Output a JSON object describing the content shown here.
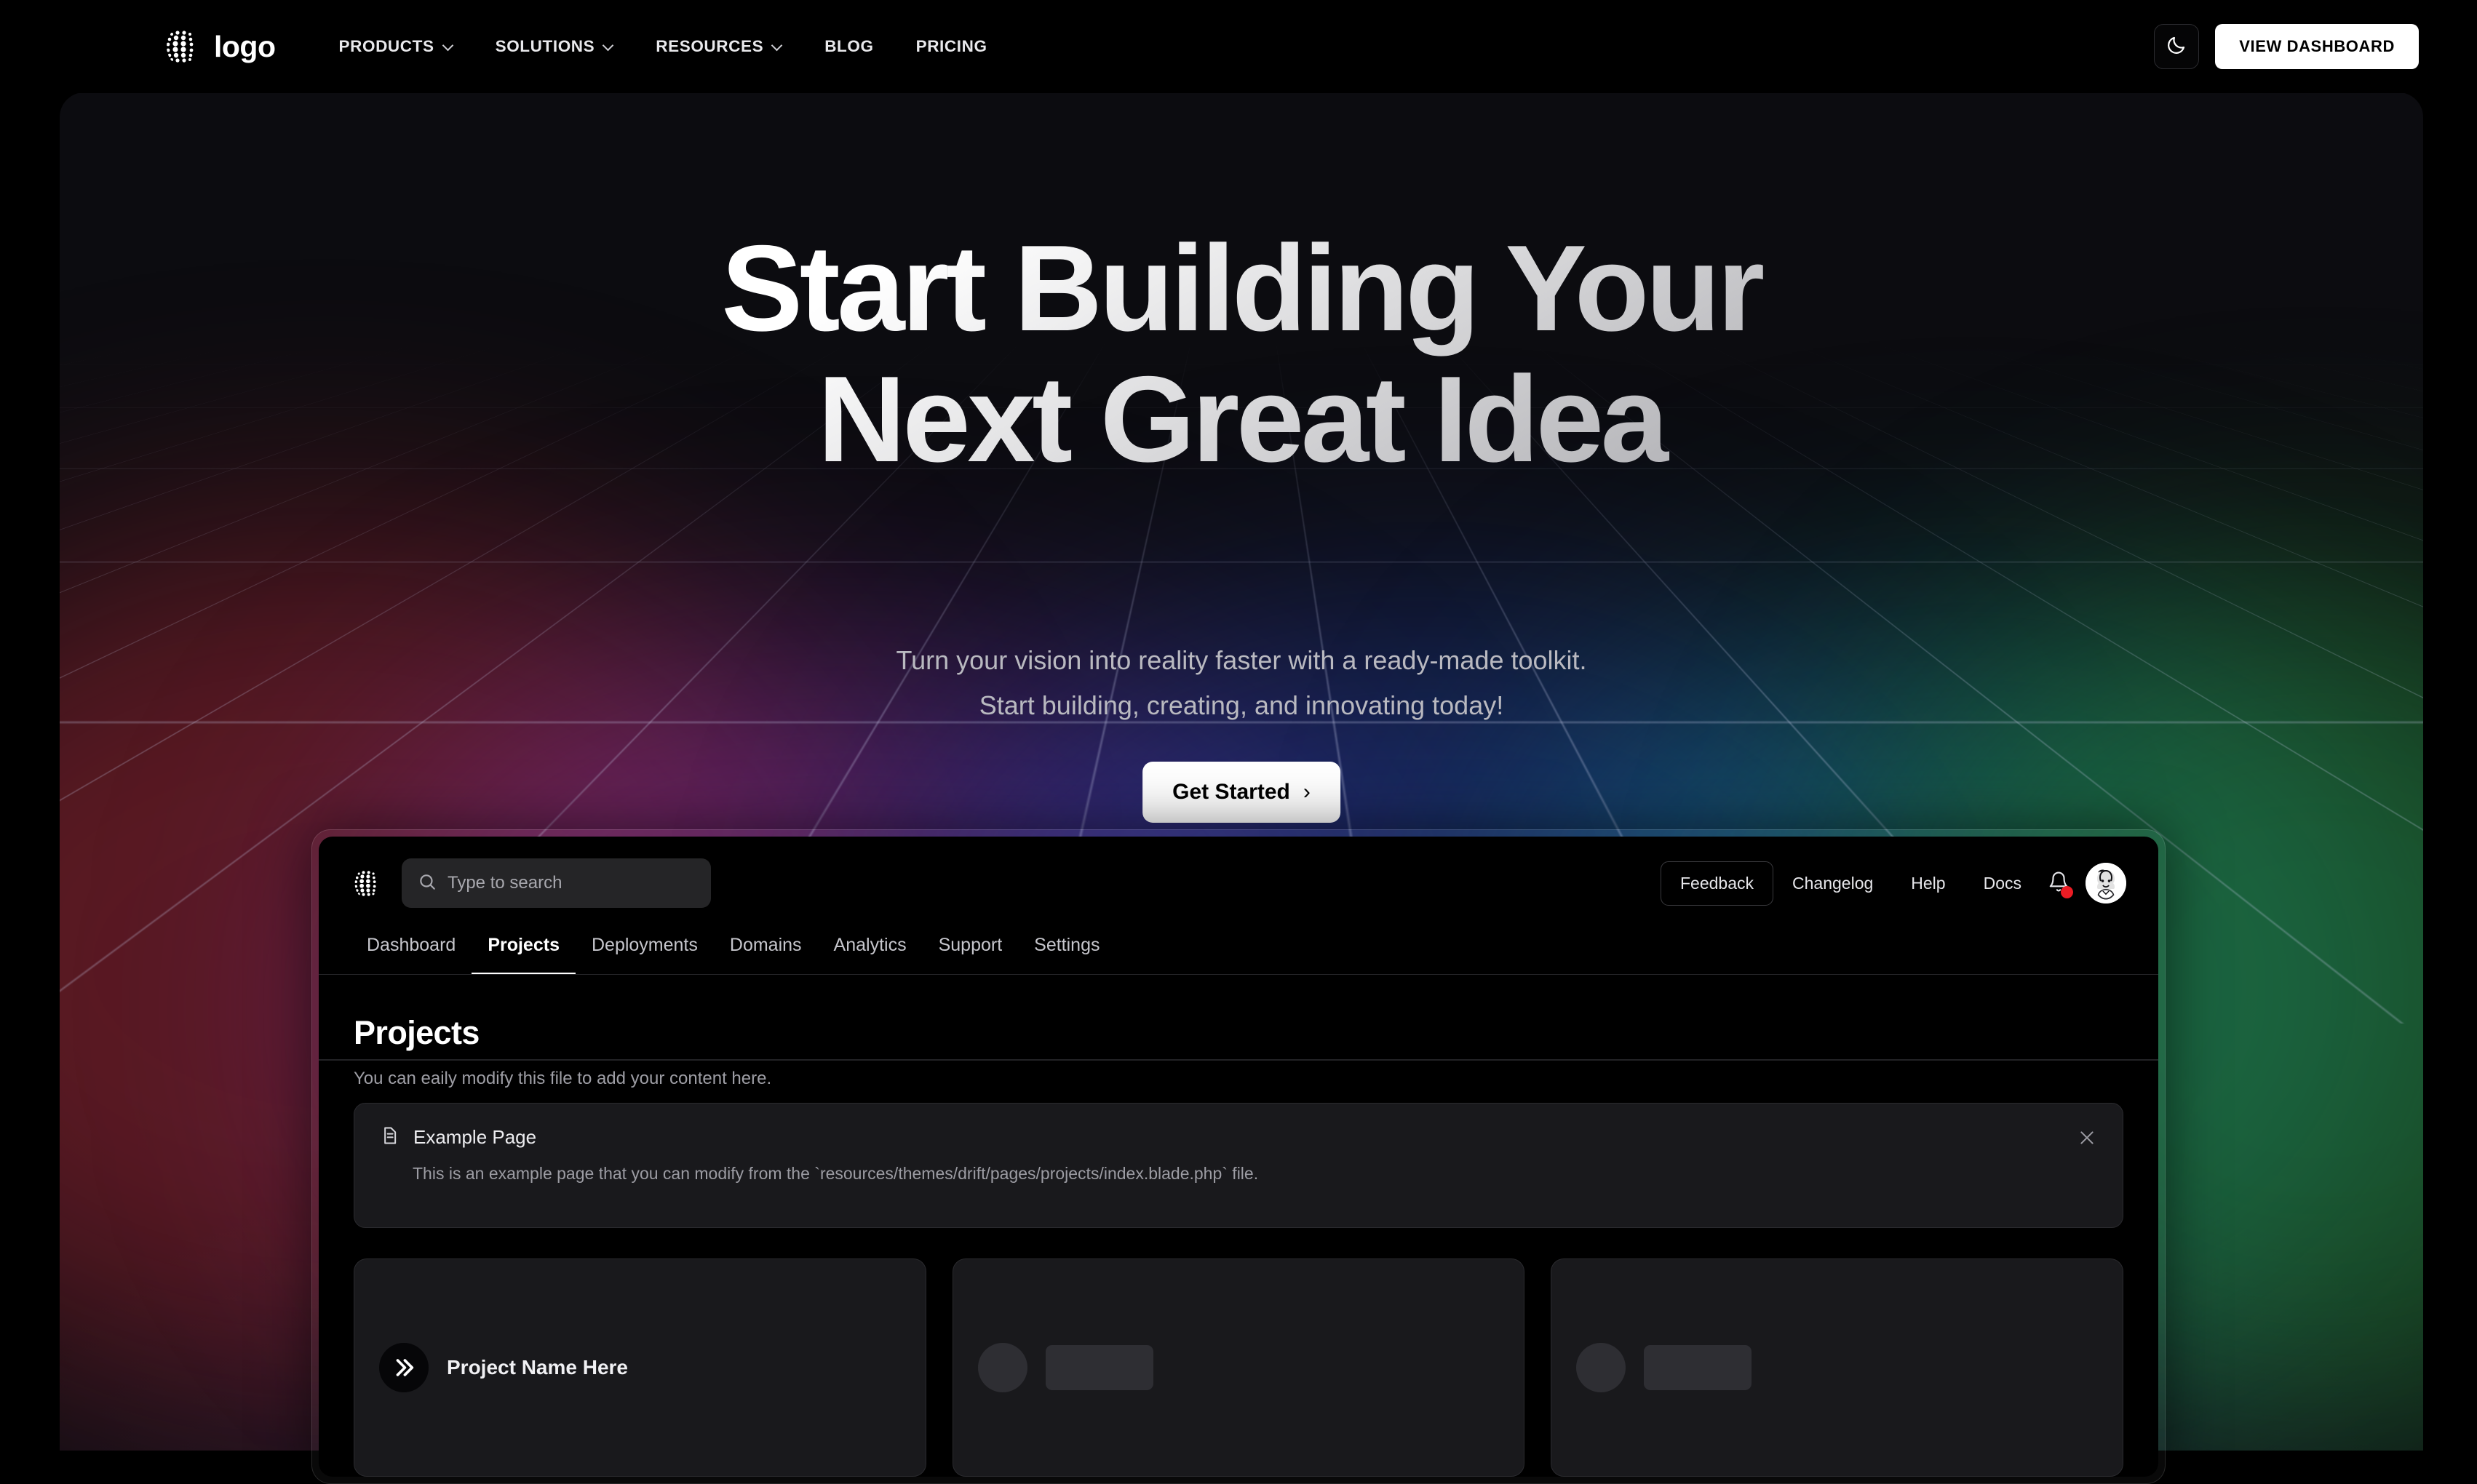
{
  "site": {
    "brand": "logo",
    "logo_icon": "dotted-globe-icon"
  },
  "topnav": {
    "items": [
      {
        "label": "PRODUCTS",
        "has_caret": true
      },
      {
        "label": "SOLUTIONS",
        "has_caret": true
      },
      {
        "label": "RESOURCES",
        "has_caret": true
      },
      {
        "label": "BLOG",
        "has_caret": false
      },
      {
        "label": "PRICING",
        "has_caret": false
      }
    ],
    "theme_toggle_icon": "moon-icon",
    "dashboard_button": "VIEW DASHBOARD"
  },
  "hero": {
    "title_line1": "Start Building Your",
    "title_line2": "Next Great Idea",
    "subtitle_line1": "Turn your vision into reality faster with a ready-made toolkit.",
    "subtitle_line2": "Start building, creating, and innovating today!",
    "cta_label": "Get Started",
    "cta_arrow": "›"
  },
  "dashboard": {
    "logo_icon": "dotted-globe-icon",
    "search": {
      "placeholder": "Type to search",
      "icon": "search-icon",
      "value": ""
    },
    "actions": {
      "feedback": "Feedback",
      "changelog": "Changelog",
      "help": "Help",
      "docs": "Docs",
      "bell_icon": "bell-icon",
      "has_notification": true,
      "avatar_icon": "user-avatar"
    },
    "tabs": [
      {
        "label": "Dashboard",
        "active": false
      },
      {
        "label": "Projects",
        "active": true
      },
      {
        "label": "Deployments",
        "active": false
      },
      {
        "label": "Domains",
        "active": false
      },
      {
        "label": "Analytics",
        "active": false
      },
      {
        "label": "Support",
        "active": false
      },
      {
        "label": "Settings",
        "active": false
      }
    ],
    "page": {
      "title": "Projects",
      "subtitle": "You can eaily modify this file to add your content here."
    },
    "alert": {
      "icon": "document-lines-icon",
      "title": "Example Page",
      "body": "This is an example page that you can modify from the `resources/themes/drift/pages/projects/index.blade.php` file.",
      "close_icon": "close-icon"
    },
    "cards": [
      {
        "name": "Project Name Here",
        "avatar_icon": "double-chevron-right-icon",
        "skeleton": false
      },
      {
        "name": "",
        "avatar_icon": "",
        "skeleton": true
      },
      {
        "name": "",
        "avatar_icon": "",
        "skeleton": true
      }
    ]
  },
  "colors": {
    "background": "#000000",
    "hero_surface": "#0c0c10",
    "accent_white": "#ffffff",
    "notification_red": "#ec1c24",
    "panel": "#19191c",
    "muted_text": "#9e9ea5"
  }
}
